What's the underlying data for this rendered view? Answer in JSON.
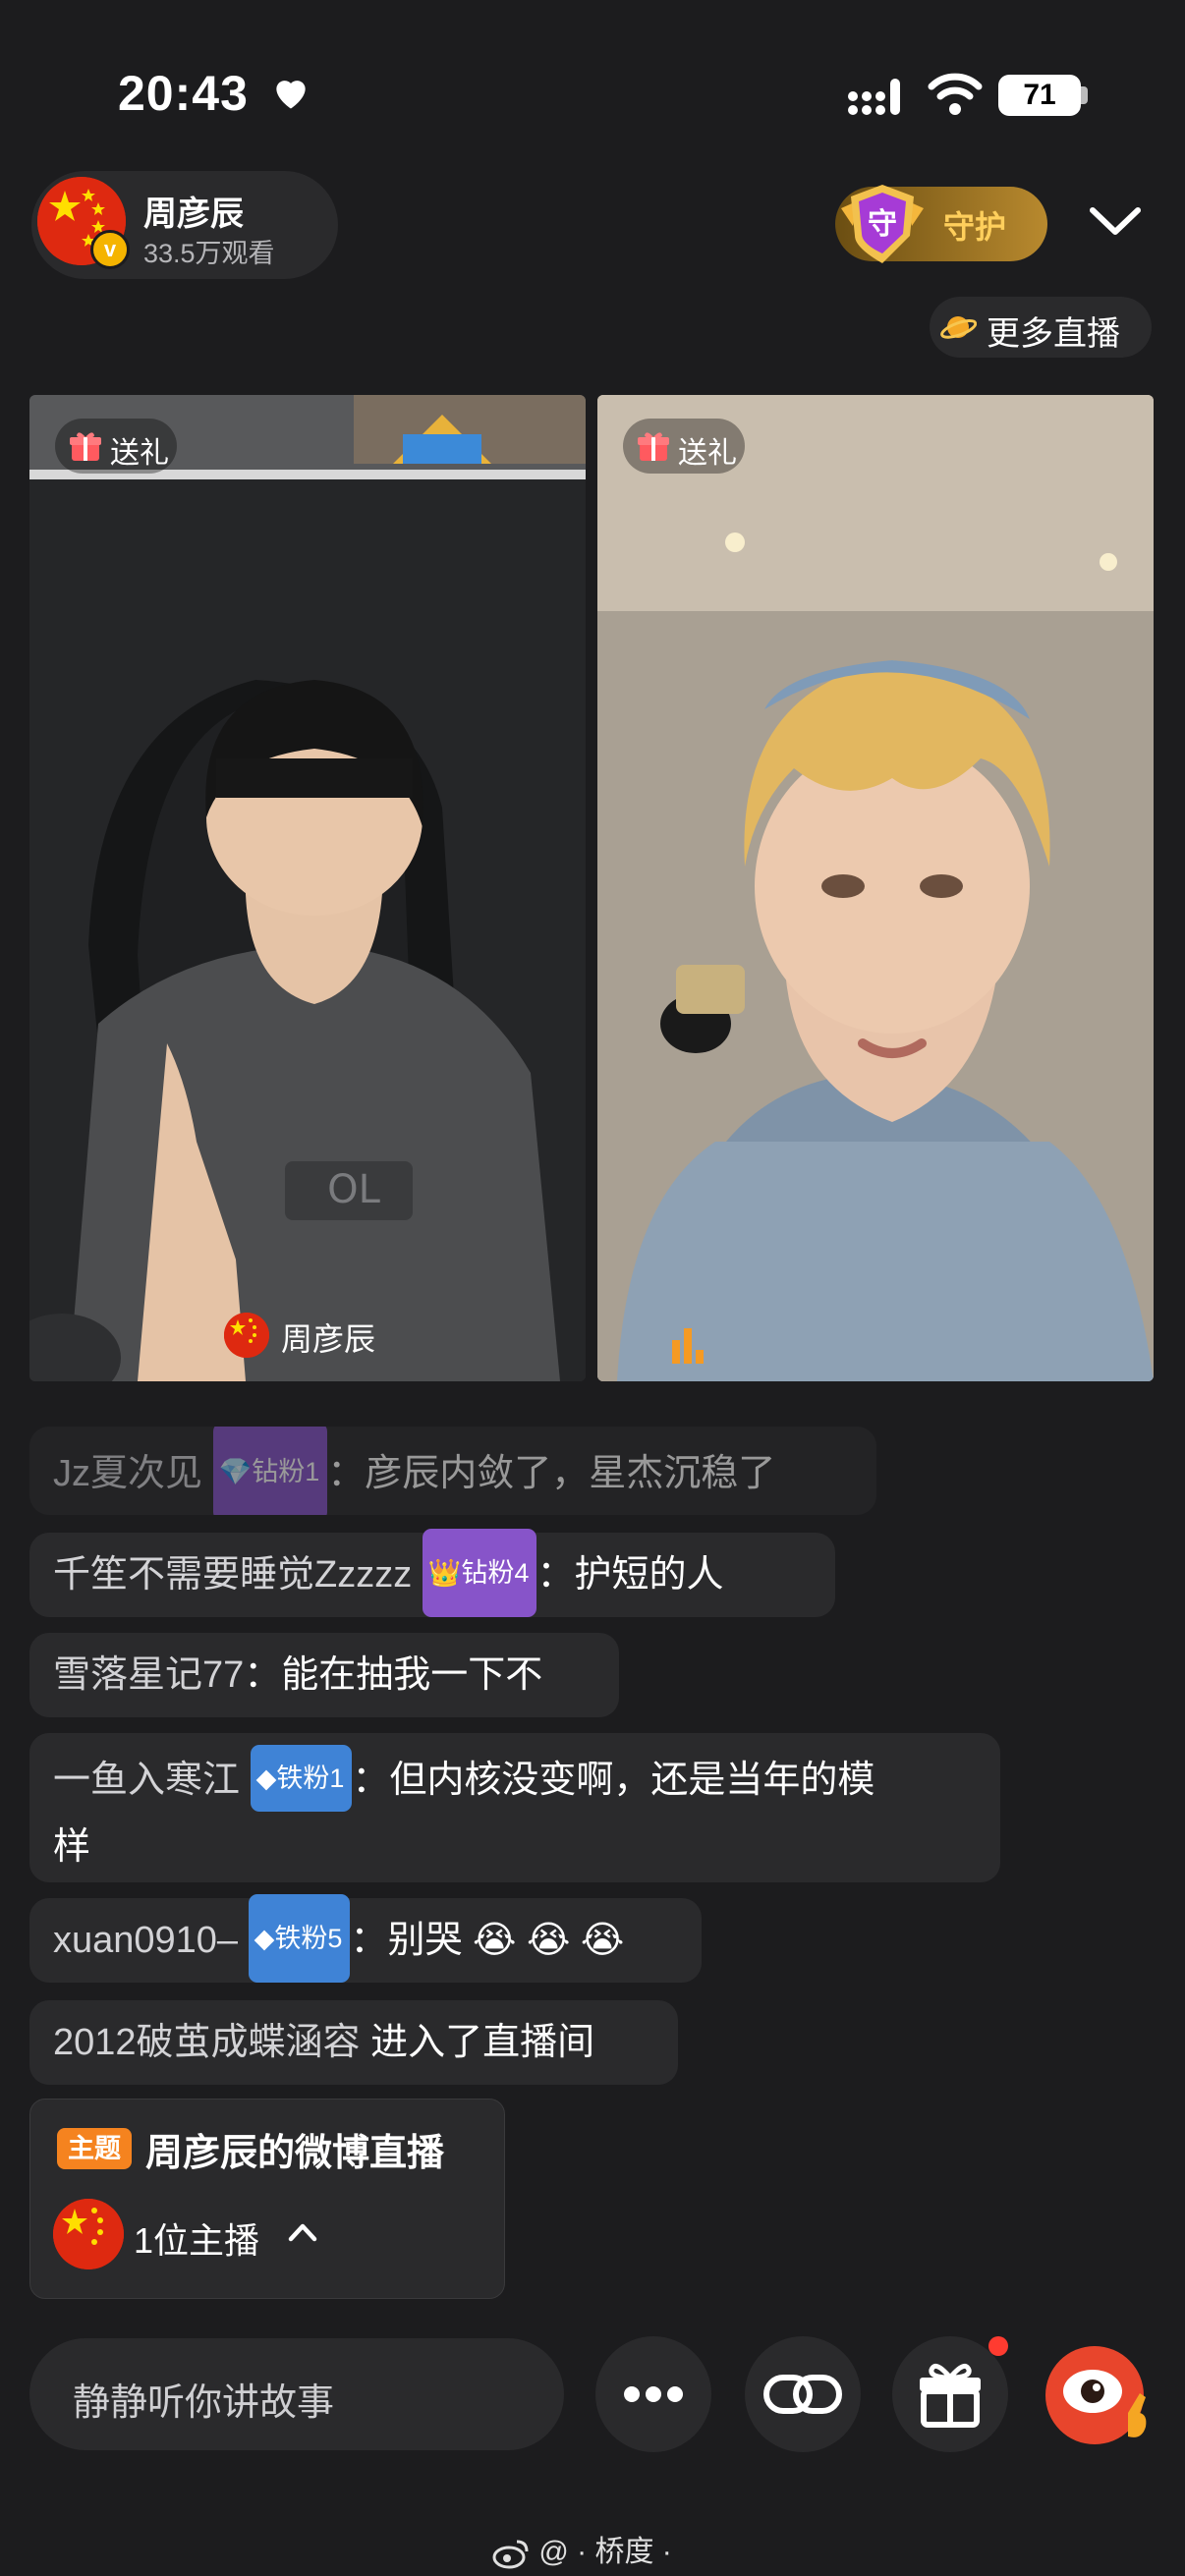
{
  "status_bar": {
    "time": "20:43",
    "battery": "71"
  },
  "host": {
    "name": "周彦辰",
    "viewers": "33.5万观看"
  },
  "guard_button": {
    "shield_char": "守",
    "label": "守护"
  },
  "more_live": {
    "label": "更多直播"
  },
  "panels": [
    {
      "gift_label": "送礼",
      "streamer_name": "周彦辰"
    },
    {
      "gift_label": "送礼"
    }
  ],
  "comments": [
    {
      "user": "Jz夏次见",
      "badge": "钻粉1",
      "sep": "：",
      "text": "彦辰内敛了，星杰沉稳了"
    },
    {
      "user": "千笙不需要睡觉Zzzzz",
      "badge": "钻粉4",
      "sep": "：",
      "text": "护短的人"
    },
    {
      "user": "雪落星记77",
      "sep": "：",
      "text": "能在抽我一下不"
    },
    {
      "user": "一鱼入寒江",
      "badge": "铁粉1",
      "sep": "：",
      "text": "但内核没变啊，还是当年的模",
      "text2": "样"
    },
    {
      "user": "xuan0910–",
      "badge": "铁粉5",
      "sep": "：",
      "text": "别哭 😭 😭 😭"
    },
    {
      "user": "2012破茧成蝶涵容",
      "text": " 进入了直播间"
    }
  ],
  "theme": {
    "tag": "主题",
    "title": "周彦辰的微博直播",
    "host_count": "1位主播"
  },
  "bottom_bar": {
    "input_placeholder": "静静听你讲故事"
  },
  "watermark": "@ · 桥度 ·",
  "colors": {
    "background": "#1c1c1e",
    "bubble": "#2a2a2c",
    "guard_gold": "#ffcf5c",
    "badge_purple": "#8754c9",
    "badge_blue": "#3f83d6",
    "theme_orange": "#f5831f",
    "notification_red": "#ff3b30"
  }
}
